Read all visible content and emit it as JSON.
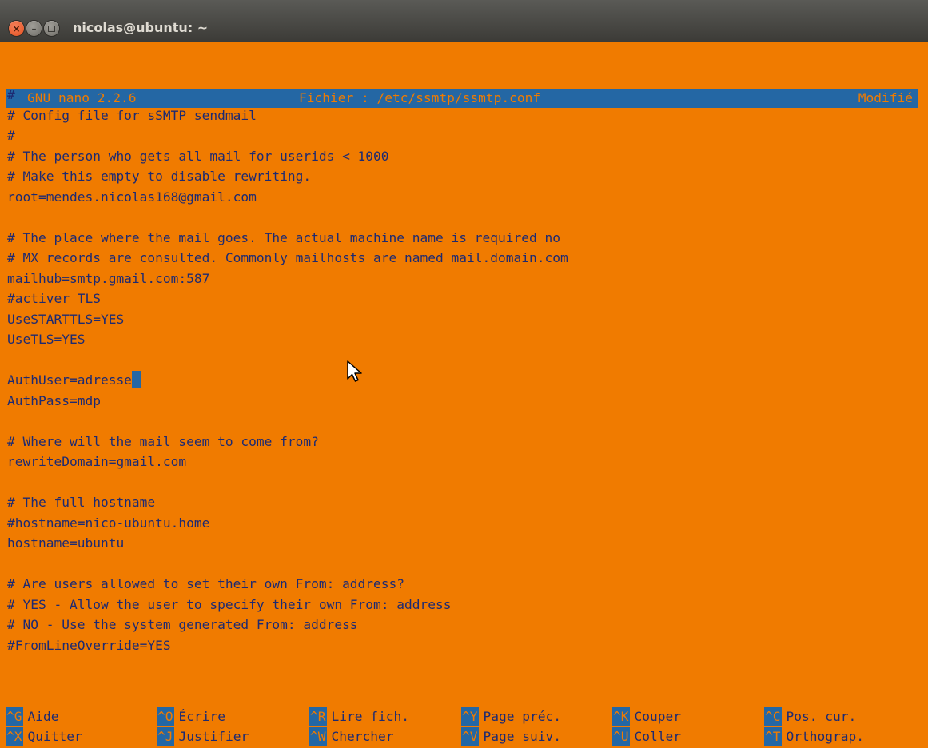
{
  "window": {
    "title": "nicolas@ubuntu: ~",
    "close_glyph": "×",
    "min_glyph": "–"
  },
  "nano": {
    "version": "GNU nano 2.2.6",
    "file": "Fichier : /etc/ssmtp/ssmtp.conf",
    "state": "Modifié",
    "lines": [
      "#",
      "# Config file for sSMTP sendmail",
      "#",
      "# The person who gets all mail for userids < 1000",
      "# Make this empty to disable rewriting.",
      "root=mendes.nicolas168@gmail.com",
      "",
      "# The place where the mail goes. The actual machine name is required no",
      "# MX records are consulted. Commonly mailhosts are named mail.domain.com",
      "mailhub=smtp.gmail.com:587",
      "#activer TLS",
      "UseSTARTTLS=YES",
      "UseTLS=YES",
      "",
      "AuthUser=adresse",
      "AuthPass=mdp",
      "",
      "# Where will the mail seem to come from?",
      "rewriteDomain=gmail.com",
      "",
      "# The full hostname",
      "#hostname=nico-ubuntu.home",
      "hostname=ubuntu",
      "",
      "# Are users allowed to set their own From: address?",
      "# YES - Allow the user to specify their own From: address",
      "# NO - Use the system generated From: address",
      "#FromLineOverride=YES"
    ],
    "shortcuts_row1": [
      {
        "key": "^G",
        "label": "Aide"
      },
      {
        "key": "^O",
        "label": "Écrire"
      },
      {
        "key": "^R",
        "label": "Lire fich."
      },
      {
        "key": "^Y",
        "label": "Page préc."
      },
      {
        "key": "^K",
        "label": "Couper"
      },
      {
        "key": "^C",
        "label": "Pos. cur."
      }
    ],
    "shortcuts_row2": [
      {
        "key": "^X",
        "label": "Quitter"
      },
      {
        "key": "^J",
        "label": "Justifier"
      },
      {
        "key": "^W",
        "label": "Chercher"
      },
      {
        "key": "^V",
        "label": "Page suiv."
      },
      {
        "key": "^U",
        "label": "Coller"
      },
      {
        "key": "^T",
        "label": "Orthograp."
      }
    ]
  },
  "colors": {
    "background": "#f07b00",
    "text": "#1d2a72",
    "highlight": "#2467a4"
  }
}
